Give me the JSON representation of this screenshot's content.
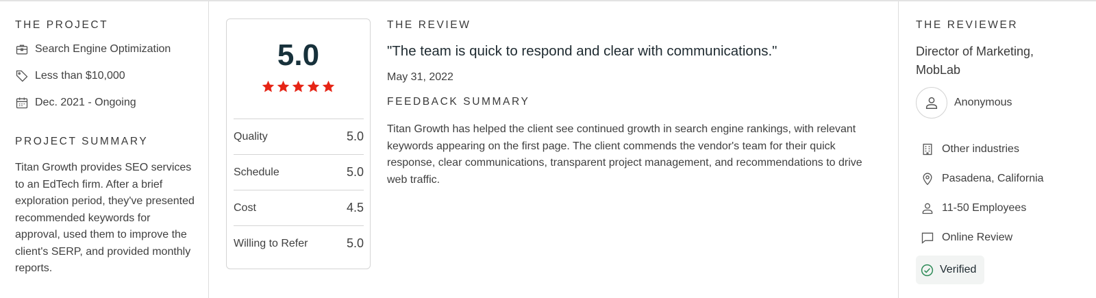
{
  "project": {
    "heading": "THE PROJECT",
    "service": "Search Engine Optimization",
    "budget": "Less than $10,000",
    "timeline": "Dec. 2021 - Ongoing",
    "summary_heading": "PROJECT SUMMARY",
    "summary": "Titan Growth provides SEO services to an EdTech firm. After a brief exploration period, they've presented recommended keywords for approval, used them to improve the client's SERP, and provided monthly reports."
  },
  "rating": {
    "overall": "5.0",
    "stars": 5,
    "star_color": "#e62415",
    "rows": [
      {
        "label": "Quality",
        "value": "5.0"
      },
      {
        "label": "Schedule",
        "value": "5.0"
      },
      {
        "label": "Cost",
        "value": "4.5"
      },
      {
        "label": "Willing to Refer",
        "value": "5.0"
      }
    ]
  },
  "review": {
    "heading": "THE REVIEW",
    "quote": "\"The team is quick to respond and clear with communications.\"",
    "date": "May 31, 2022",
    "feedback_heading": "FEEDBACK SUMMARY",
    "feedback": "Titan Growth has helped the client see continued growth in search engine rankings, with relevant keywords appearing on the first page. The client commends the vendor's team for their quick response, clear communications, transparent project management, and recommendations to drive web traffic."
  },
  "reviewer": {
    "heading": "THE REVIEWER",
    "title": "Director of Marketing, MobLab",
    "name": "Anonymous",
    "industry": "Other industries",
    "location": "Pasadena, California",
    "size": "11-50 Employees",
    "review_type": "Online Review",
    "verified": "Verified",
    "verified_color": "#2e8b57"
  },
  "icons": {
    "service": "briefcase-icon",
    "budget": "price-tag-icon",
    "timeline": "calendar-icon",
    "avatar": "user-icon",
    "industry": "building-icon",
    "location": "map-pin-icon",
    "size": "person-icon",
    "review_type": "chat-bubble-icon",
    "verified": "check-circle-icon"
  }
}
